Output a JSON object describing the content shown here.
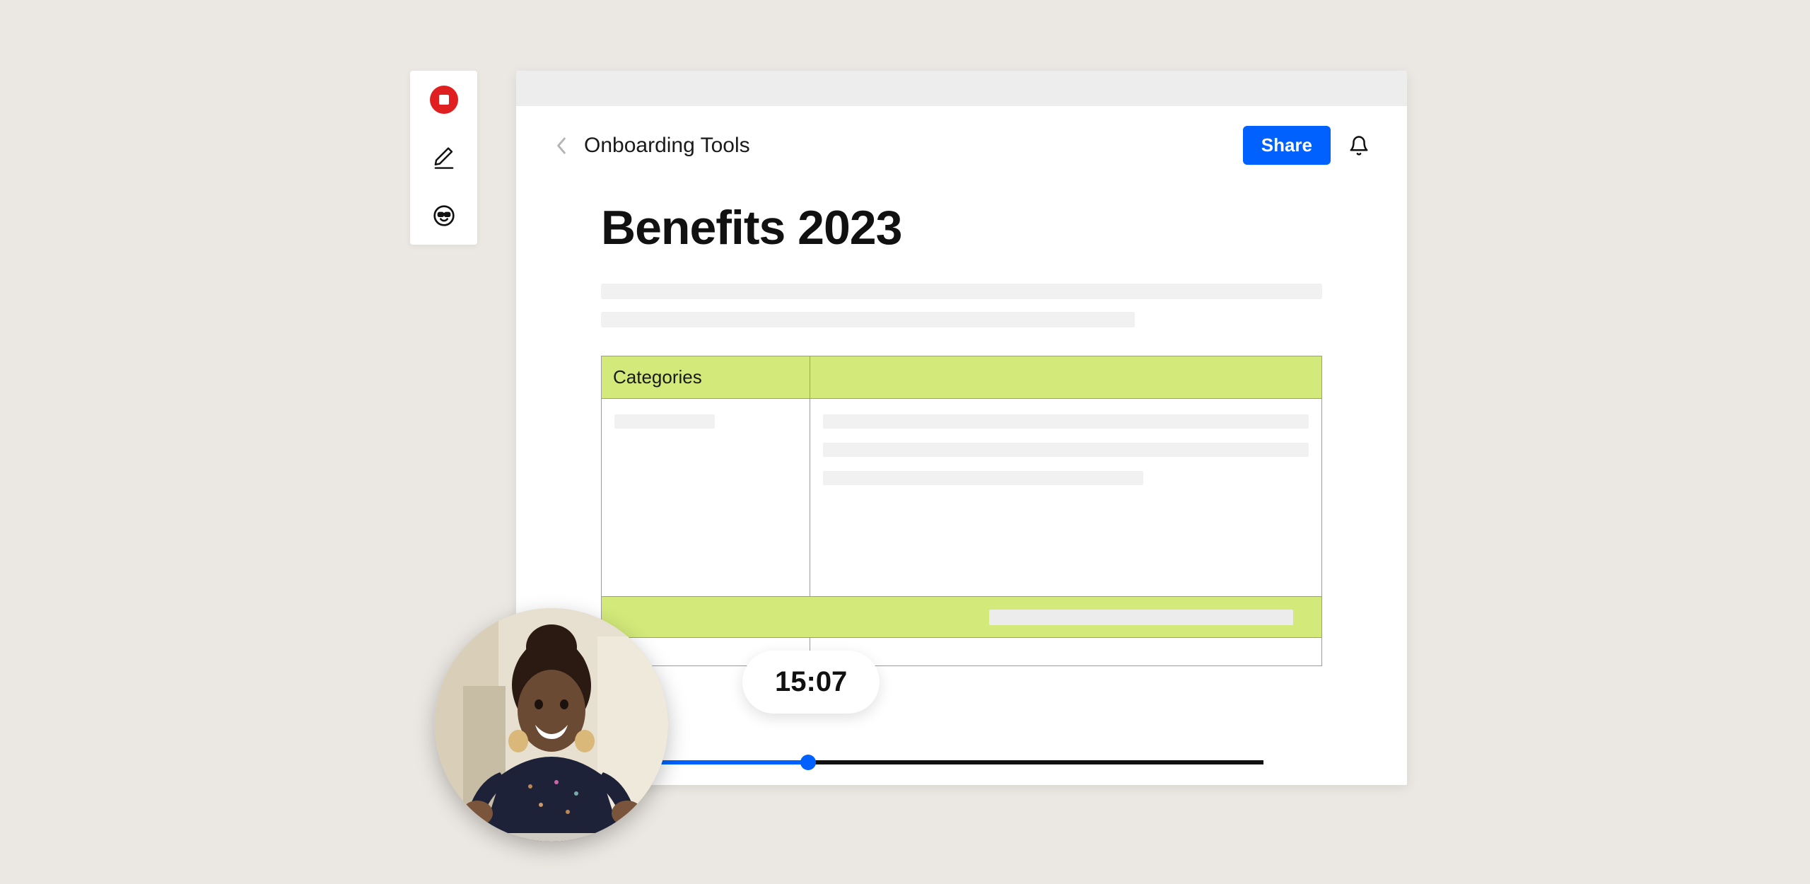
{
  "toolbar": {
    "buttons": [
      {
        "name": "record-button",
        "icon": "record-stop-icon"
      },
      {
        "name": "draw-button",
        "icon": "pencil-icon"
      },
      {
        "name": "emoji-button",
        "icon": "face-sunglasses-icon"
      }
    ]
  },
  "header": {
    "breadcrumb": "Onboarding Tools",
    "share_label": "Share"
  },
  "document": {
    "title": "Benefits 2023",
    "table": {
      "column1_header": "Categories"
    }
  },
  "recording": {
    "timestamp": "15:07",
    "progress_percent": 30
  },
  "colors": {
    "accent_blue": "#0061fe",
    "record_red": "#e02020",
    "table_green": "#d3e97a",
    "background": "#ebe7e2"
  }
}
